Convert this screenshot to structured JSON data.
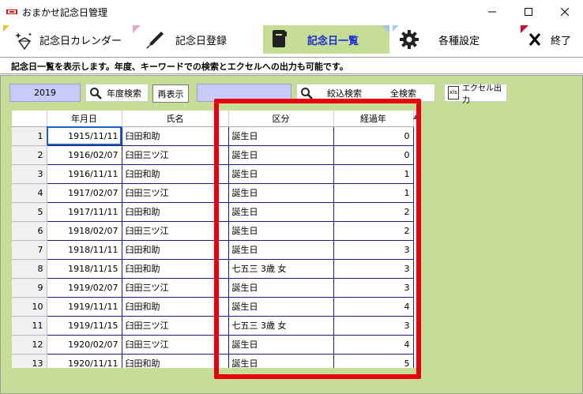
{
  "window": {
    "title": "おまかせ記念日管理",
    "minimize": "—",
    "maximize": "☐",
    "close": "✕"
  },
  "tabs": [
    {
      "label": "記念日カレンダー",
      "icon": "sparkle-diamond-icon",
      "corner_color": "#e6c43a"
    },
    {
      "label": "記念日登録",
      "icon": "pen-icon",
      "corner_color": "#e9a7be"
    },
    {
      "label": "記念日一覧",
      "icon": "notebook-icon",
      "corner_color": "#a9c4e8",
      "active": true
    },
    {
      "label": "各種設定",
      "icon": "gear-icon",
      "corner_color": "#a6d1e6"
    },
    {
      "label": "終了",
      "icon": "x-mark-icon",
      "corner_color": "#c8102e"
    }
  ],
  "info": {
    "text": "記念日一覧を表示します。年度、キーワードでの検索とエクセルへの出力も可能です。"
  },
  "toolbar": {
    "year_value": "2019",
    "year_search_label": "年度検索",
    "redisplay_label": "再表示",
    "filter_value": "",
    "filter_search_label": "絞込検索",
    "all_search_label": "全検索",
    "excel_label": "エクセル出力",
    "excel_icon_text": "xls"
  },
  "table": {
    "headers": [
      "",
      "年月日",
      "氏名",
      "区分",
      "経過年"
    ],
    "rows": [
      {
        "no": "1",
        "date": "1915/11/11",
        "name": "臼田和助",
        "category": "誕生日",
        "years": "0"
      },
      {
        "no": "2",
        "date": "1916/02/07",
        "name": "臼田三ツ江",
        "category": "誕生日",
        "years": "0"
      },
      {
        "no": "3",
        "date": "1916/11/11",
        "name": "臼田和助",
        "category": "誕生日",
        "years": "1"
      },
      {
        "no": "4",
        "date": "1917/02/07",
        "name": "臼田三ツ江",
        "category": "誕生日",
        "years": "1"
      },
      {
        "no": "5",
        "date": "1917/11/11",
        "name": "臼田和助",
        "category": "誕生日",
        "years": "2"
      },
      {
        "no": "6",
        "date": "1918/02/07",
        "name": "臼田三ツ江",
        "category": "誕生日",
        "years": "2"
      },
      {
        "no": "7",
        "date": "1918/11/11",
        "name": "臼田和助",
        "category": "誕生日",
        "years": "3"
      },
      {
        "no": "8",
        "date": "1918/11/15",
        "name": "臼田和助",
        "category": "七五三 3歳 女",
        "years": "3"
      },
      {
        "no": "9",
        "date": "1919/02/07",
        "name": "臼田三ツ江",
        "category": "誕生日",
        "years": "3"
      },
      {
        "no": "10",
        "date": "1919/11/11",
        "name": "臼田和助",
        "category": "誕生日",
        "years": "4"
      },
      {
        "no": "11",
        "date": "1919/11/15",
        "name": "臼田三ツ江",
        "category": "七五三 3歳 女",
        "years": "3"
      },
      {
        "no": "12",
        "date": "1920/02/07",
        "name": "臼田三ツ江",
        "category": "誕生日",
        "years": "4"
      },
      {
        "no": "13",
        "date": "1920/11/11",
        "name": "臼田和助",
        "category": "誕生日",
        "years": "5"
      }
    ]
  },
  "colors": {
    "content_bg": "#c5dd94",
    "input_bg": "#c8caf8",
    "highlight": "#e8000c",
    "active_tab": "#c5dd94",
    "active_tab_text": "#1a2bd6"
  }
}
